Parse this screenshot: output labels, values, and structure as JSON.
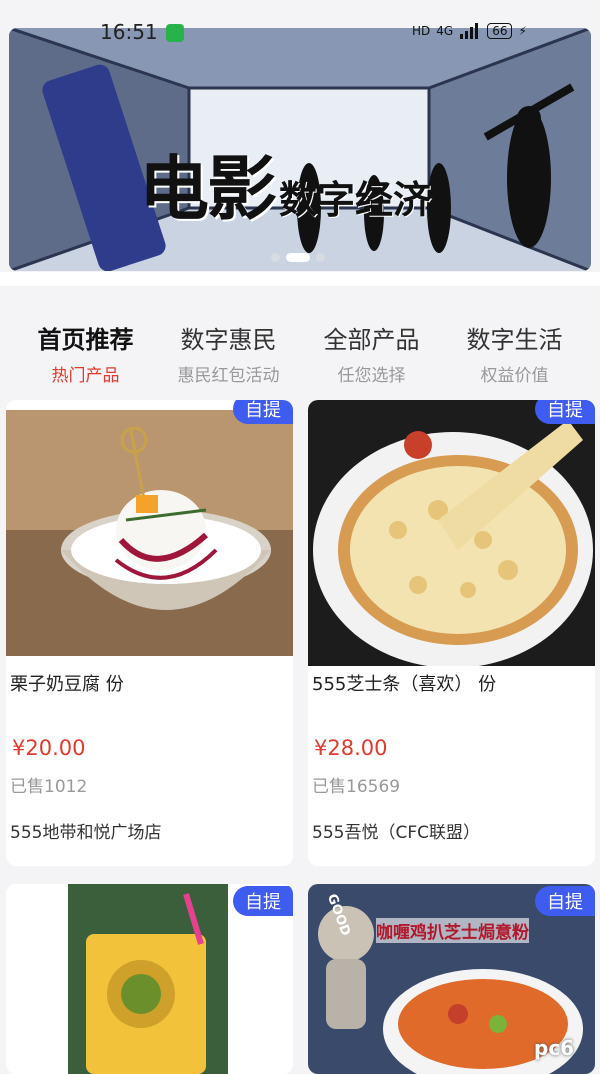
{
  "status_bar": {
    "time": "16:51",
    "network": "HD",
    "signal": "4G",
    "battery": "66"
  },
  "banner": {
    "title_big": "电影",
    "title_small": "数字经济",
    "dot_count": 3,
    "active_dot": 1
  },
  "tabs": [
    {
      "title": "首页推荐",
      "subtitle": "热门产品"
    },
    {
      "title": "数字惠民",
      "subtitle": "惠民红包活动"
    },
    {
      "title": "全部产品",
      "subtitle": "任您选择"
    },
    {
      "title": "数字生活",
      "subtitle": "权益价值"
    }
  ],
  "products": [
    {
      "badge": "自提",
      "name": "栗子奶豆腐 份",
      "price": "¥20.00",
      "sold": "已售1012",
      "shop": "555地带和悦广场店"
    },
    {
      "badge": "自提",
      "name": "555芝士条（喜欢） 份",
      "price": "¥28.00",
      "sold": "已售16569",
      "shop": "555吾悦（CFC联盟）"
    },
    {
      "badge": "自提"
    },
    {
      "badge": "自提",
      "image_caption": "咖喱鸡扒芝士焗意粉",
      "image_sign": "GOOD"
    }
  ],
  "watermark": "pc6"
}
